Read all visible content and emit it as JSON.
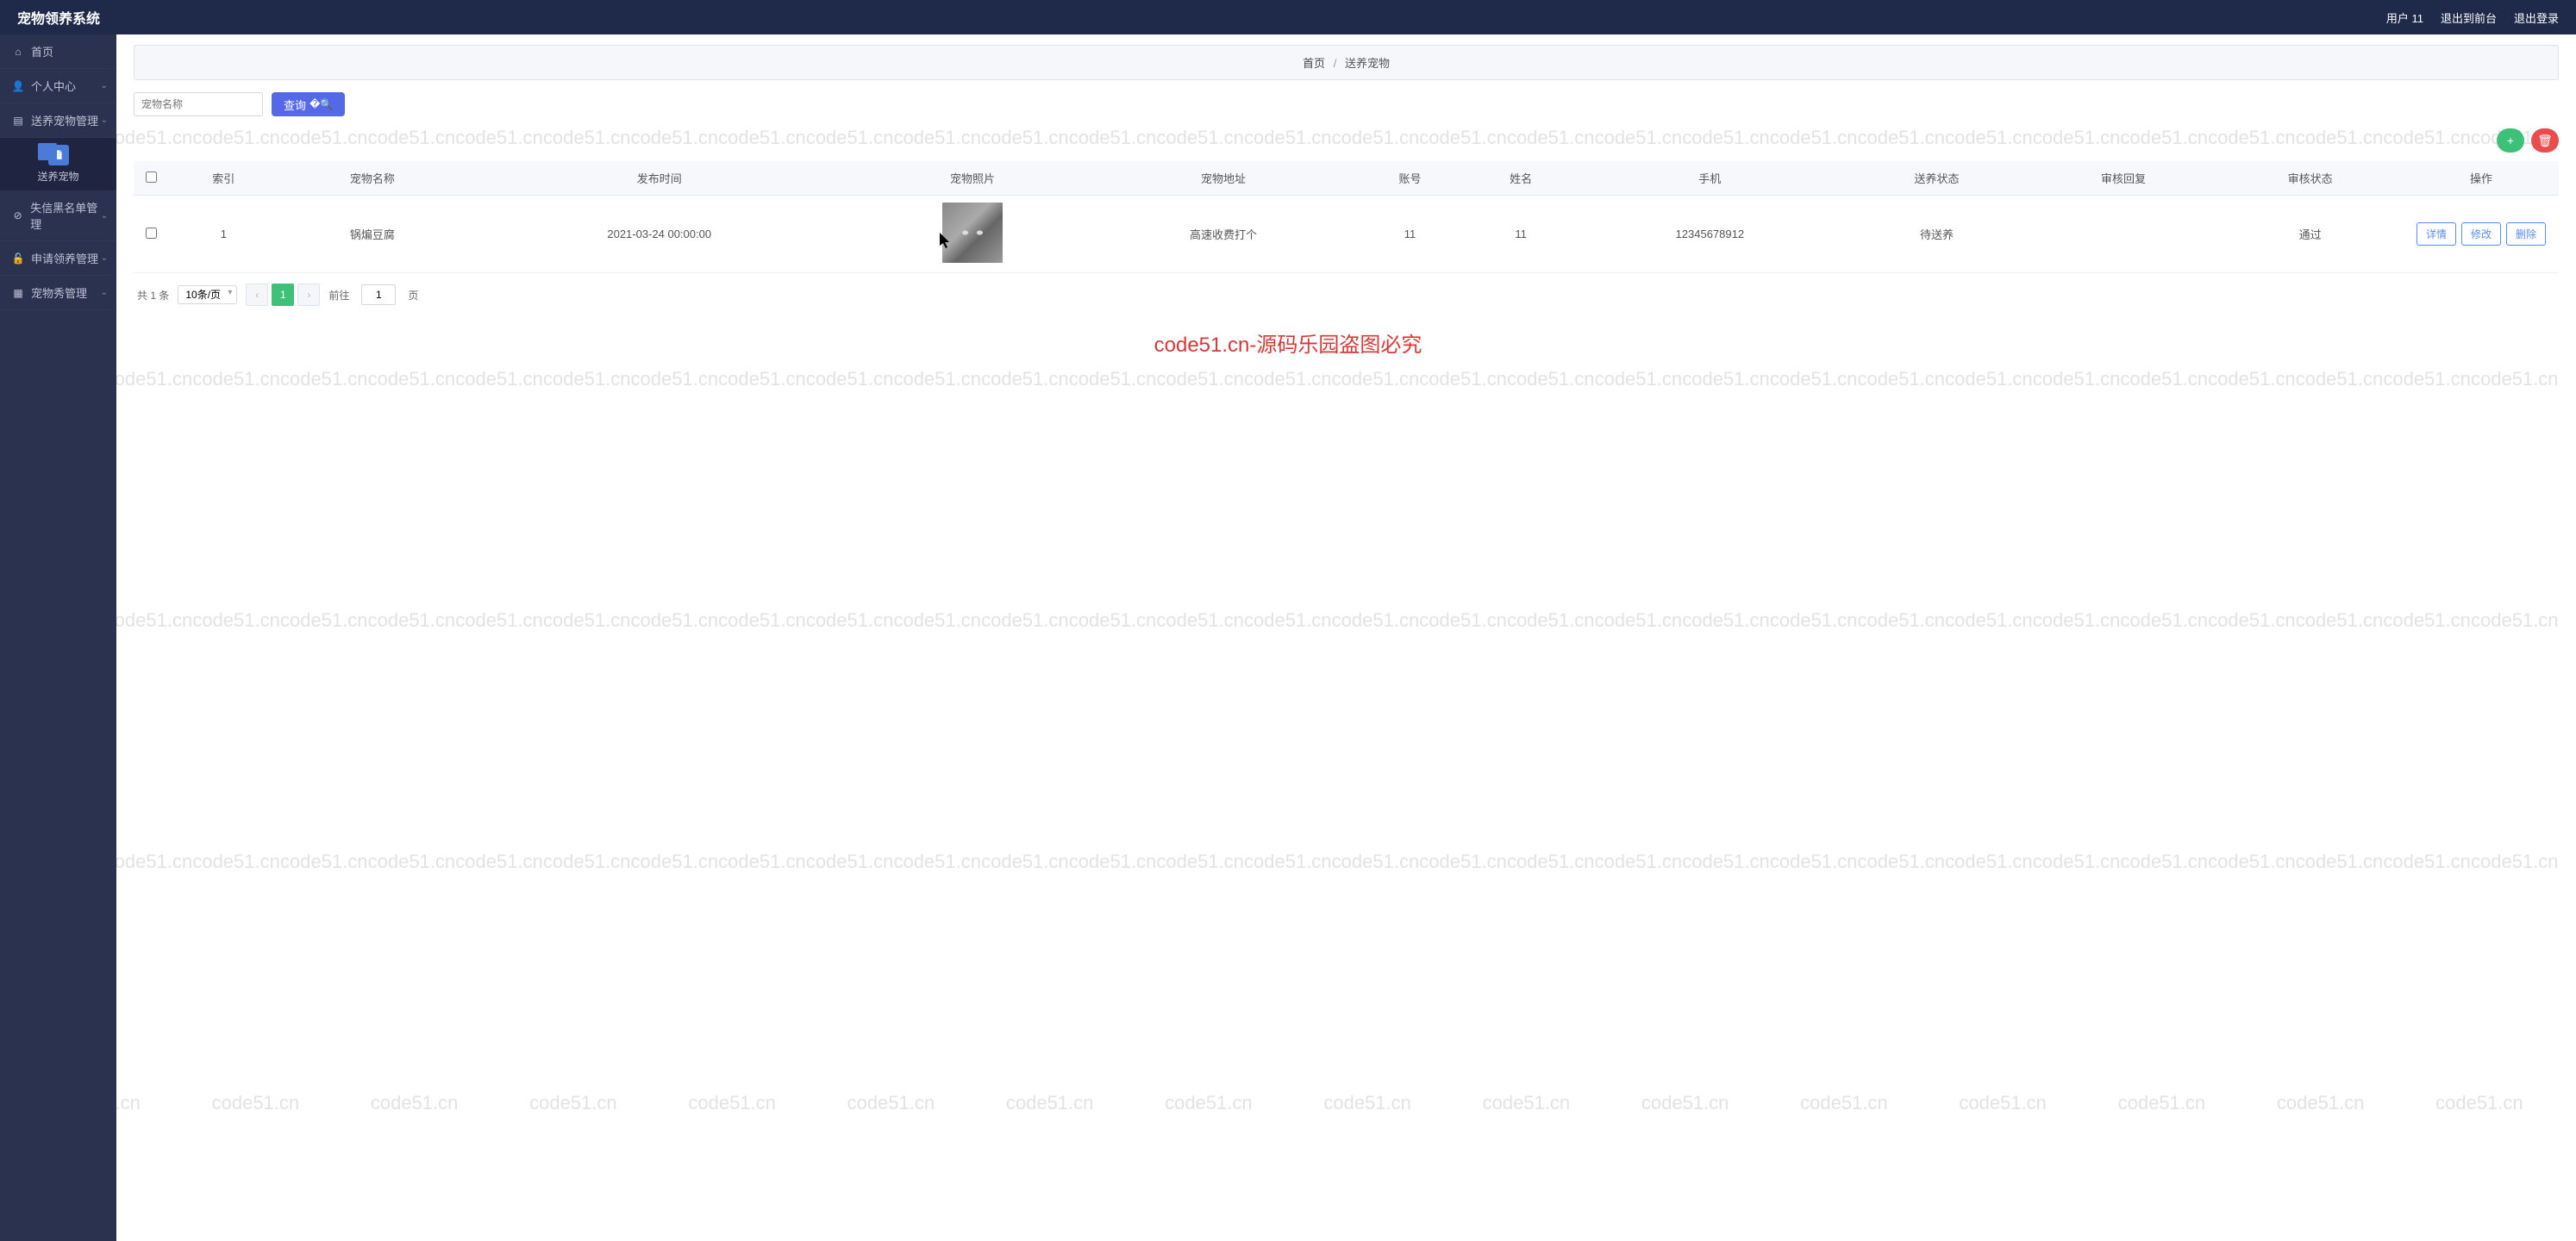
{
  "header": {
    "title": "宠物领养系统",
    "user_label": "用户 11",
    "logout_front": "退出到前台",
    "logout": "退出登录"
  },
  "sidebar": {
    "items": [
      {
        "icon": "⌂",
        "label": "首页",
        "has_children": false
      },
      {
        "icon": "👤",
        "label": "个人中心",
        "has_children": true
      },
      {
        "icon": "▤",
        "label": "送养宠物管理",
        "has_children": true
      },
      {
        "icon": "⊘",
        "label": "失信黑名单管理",
        "has_children": true
      },
      {
        "icon": "🔒",
        "label": "申请领养管理",
        "has_children": true
      },
      {
        "icon": "▦",
        "label": "宠物秀管理",
        "has_children": true
      }
    ],
    "sub_item_label": "送养宠物"
  },
  "breadcrumb": {
    "home": "首页",
    "current": "送养宠物"
  },
  "search": {
    "placeholder": "宠物名称",
    "button": "查询"
  },
  "table": {
    "headers": [
      "",
      "索引",
      "宠物名称",
      "发布时间",
      "宠物照片",
      "宠物地址",
      "账号",
      "姓名",
      "手机",
      "送养状态",
      "审核回复",
      "审核状态",
      "操作"
    ],
    "rows": [
      {
        "index": "1",
        "pet_name": "锅煸豆腐",
        "publish_time": "2021-03-24 00:00:00",
        "address": "高速收费打个",
        "account": "11",
        "name": "11",
        "phone": "12345678912",
        "send_status": "待送养",
        "review_reply": "",
        "review_status": "通过"
      }
    ],
    "action_buttons": {
      "detail": "详情",
      "edit": "修改",
      "delete": "删除"
    }
  },
  "pagination": {
    "total_label": "共 1 条",
    "page_size": "10条/页",
    "current_page": "1",
    "goto_label": "前往",
    "goto_value": "1",
    "page_suffix": "页"
  },
  "watermark_text": "code51.cn",
  "center_watermark": "code51.cn-源码乐园盗图必究"
}
